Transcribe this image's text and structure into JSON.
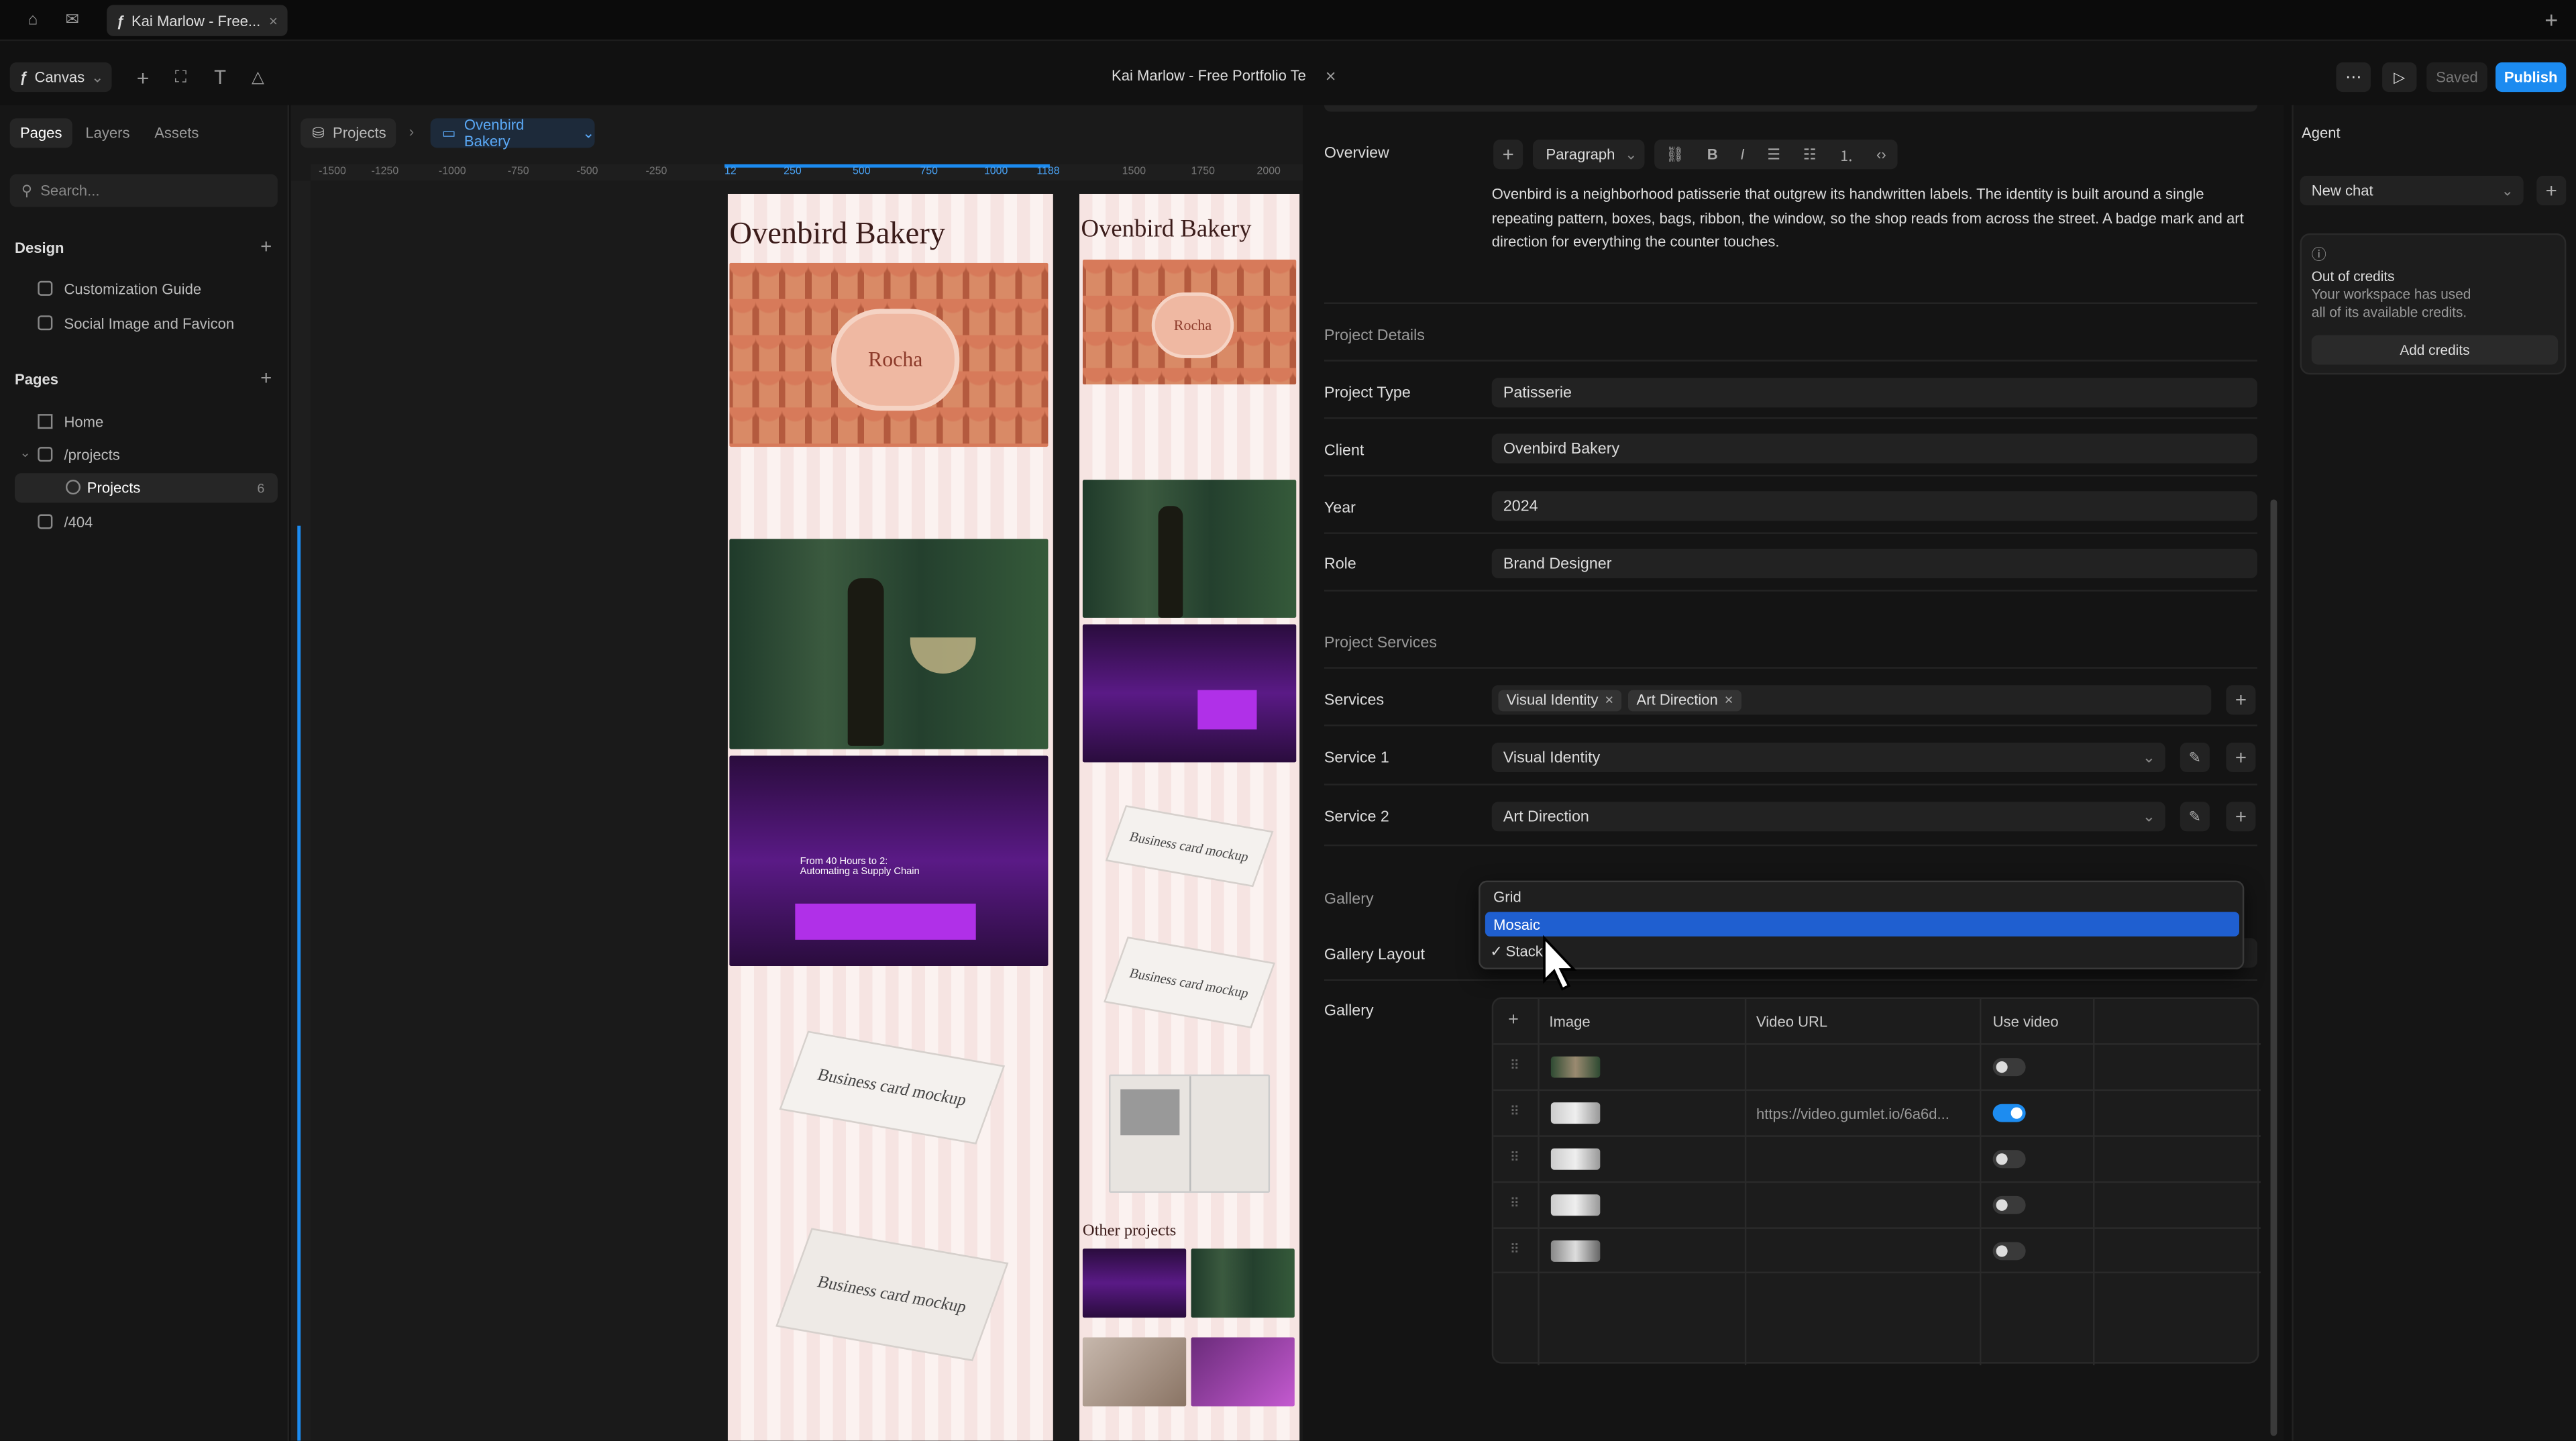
{
  "top_tab": {
    "title": "Kai Marlow - Free..."
  },
  "toolbar": {
    "canvas_label": "Canvas",
    "doc_title": "Kai Marlow - Free Portfolio Te",
    "saved_label": "Saved",
    "publish_label": "Publish"
  },
  "left_panel": {
    "tabs": [
      "Pages",
      "Layers",
      "Assets"
    ],
    "search_placeholder": "Search...",
    "design_title": "Design",
    "design_items": [
      "Customization Guide",
      "Social Image and Favicon"
    ],
    "pages_title": "Pages",
    "pages": [
      {
        "label": "Home"
      },
      {
        "label": "/projects"
      },
      {
        "label": "Projects",
        "count": "6"
      },
      {
        "label": "/404"
      }
    ]
  },
  "canvas": {
    "breadcrumb_root": "Projects",
    "breadcrumb_current": "Ovenbird Bakery",
    "ruler_ticks": [
      "-1500",
      "-1250",
      "-1000",
      "-750",
      "-500",
      "-250",
      "12",
      "250",
      "500",
      "750",
      "1000",
      "1188",
      "1500",
      "1750",
      "2000"
    ],
    "frame_title": "Ovenbird Bakery",
    "box_label": "Rocha",
    "mockup_label": "Business card mockup",
    "supply_heading": "From 40 Hours to 2: Automating a Supply Chain",
    "other_projects": "Other projects"
  },
  "editor": {
    "overview_label": "Overview",
    "paragraph_select": "Paragraph",
    "overview_text": "Ovenbird is a neighborhood patisserie that outgrew its handwritten labels. The identity is built around a single repeating pattern, boxes, bags, ribbon, the window, so the shop reads from across the street. A badge mark and art direction for everything the counter touches.",
    "details_heading": "Project Details",
    "fields": [
      {
        "label": "Project Type",
        "value": "Patisserie"
      },
      {
        "label": "Client",
        "value": "Ovenbird Bakery"
      },
      {
        "label": "Year",
        "value": "2024"
      },
      {
        "label": "Role",
        "value": "Brand Designer"
      }
    ],
    "services_heading": "Project Services",
    "services_label": "Services",
    "services_chips": [
      "Visual Identity",
      "Art Direction"
    ],
    "service1_label": "Service 1",
    "service1_value": "Visual Identity",
    "service2_label": "Service 2",
    "service2_value": "Art Direction",
    "gallery_heading": "Gallery",
    "gallery_layout_label": "Gallery Layout",
    "gallery_label": "Gallery",
    "dropdown_options": [
      "Grid",
      "Mosaic",
      "Stack"
    ],
    "dropdown_checked": "Stack",
    "dropdown_highlighted": "Mosaic",
    "gallery_table": {
      "columns": [
        "Image",
        "Video URL",
        "Use video"
      ],
      "rows": [
        {
          "video_url": "",
          "use_video": false
        },
        {
          "video_url": "https://video.gumlet.io/6a6d...",
          "use_video": true
        },
        {
          "video_url": "",
          "use_video": false
        },
        {
          "video_url": "",
          "use_video": false
        },
        {
          "video_url": "",
          "use_video": false
        }
      ]
    }
  },
  "agent": {
    "title": "Agent",
    "chat_select": "New chat",
    "credits_title": "Out of credits",
    "credits_text": "Your workspace has used all of its available credits.",
    "add_credits": "Add credits"
  },
  "colors": {
    "accent": "#1c8bf0",
    "highlight": "#1f5fd0"
  }
}
